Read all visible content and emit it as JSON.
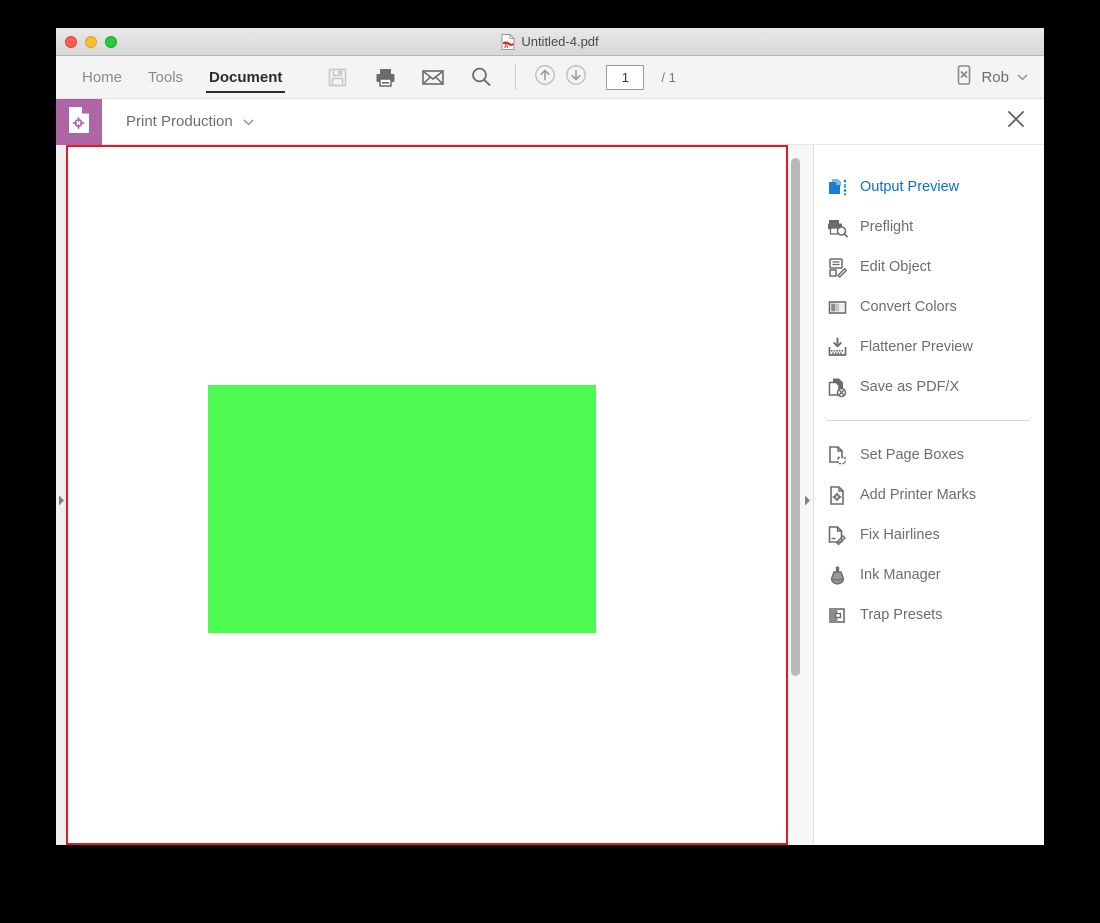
{
  "window": {
    "title": "Untitled-4.pdf",
    "file_icon": "pdf-file-icon",
    "traffic_lights": [
      {
        "name": "close",
        "color": "#ff5f57"
      },
      {
        "name": "minimize",
        "color": "#febc2e"
      },
      {
        "name": "zoom",
        "color": "#28c840"
      }
    ]
  },
  "toolbar": {
    "tabs": [
      {
        "label": "Home",
        "active": false
      },
      {
        "label": "Tools",
        "active": false
      },
      {
        "label": "Document",
        "active": true
      }
    ],
    "icons": [
      {
        "name": "save-icon",
        "enabled": false
      },
      {
        "name": "print-icon",
        "enabled": true
      },
      {
        "name": "mail-icon",
        "enabled": true
      },
      {
        "name": "search-icon",
        "enabled": true
      }
    ],
    "nav": {
      "previous_page_icon": "arrow-up-circle-icon",
      "next_page_icon": "arrow-down-circle-icon",
      "page_number": "1",
      "page_number_placeholder": "1",
      "page_count": "/ 1"
    },
    "user": {
      "device_icon": "mobile-device-x-icon",
      "name": "Rob",
      "chevron": "chevron-down-icon"
    }
  },
  "tool_bar": {
    "tile_icon": "print-production-document-icon",
    "tile_color": "#ad65a6",
    "title": "Print Production",
    "chevron": "chevron-down-icon",
    "close_icon": "close-icon"
  },
  "document": {
    "page_border_color": "#e01b24",
    "background": "#ffffff",
    "objects": [
      {
        "name": "green-rectangle",
        "color": "#4dfa52"
      }
    ],
    "left_rail_icon": "collapse-arrow-right-icon",
    "right_rail_icon": "collapse-arrow-right-icon",
    "scrollbar": {
      "name": "vertical-scrollbar",
      "thumb_color": "#b9b9b9"
    }
  },
  "side_panel": {
    "group_one": [
      {
        "label": "Output Preview",
        "icon": "output-preview-icon",
        "active": true
      },
      {
        "label": "Preflight",
        "icon": "preflight-icon",
        "active": false
      },
      {
        "label": "Edit Object",
        "icon": "edit-object-icon",
        "active": false
      },
      {
        "label": "Convert Colors",
        "icon": "convert-colors-icon",
        "active": false
      },
      {
        "label": "Flattener Preview",
        "icon": "flattener-preview-icon",
        "active": false
      },
      {
        "label": "Save as PDF/X",
        "icon": "save-as-pdfx-icon",
        "active": false
      }
    ],
    "group_two": [
      {
        "label": "Set Page Boxes",
        "icon": "set-page-boxes-icon",
        "active": false
      },
      {
        "label": "Add Printer Marks",
        "icon": "add-printer-marks-icon",
        "active": false
      },
      {
        "label": "Fix Hairlines",
        "icon": "fix-hairlines-icon",
        "active": false
      },
      {
        "label": "Ink Manager",
        "icon": "ink-manager-icon",
        "active": false
      },
      {
        "label": "Trap Presets",
        "icon": "trap-presets-icon",
        "active": false
      }
    ],
    "active_color": "#0f6fc5",
    "label_color": "#6d6d6d"
  }
}
